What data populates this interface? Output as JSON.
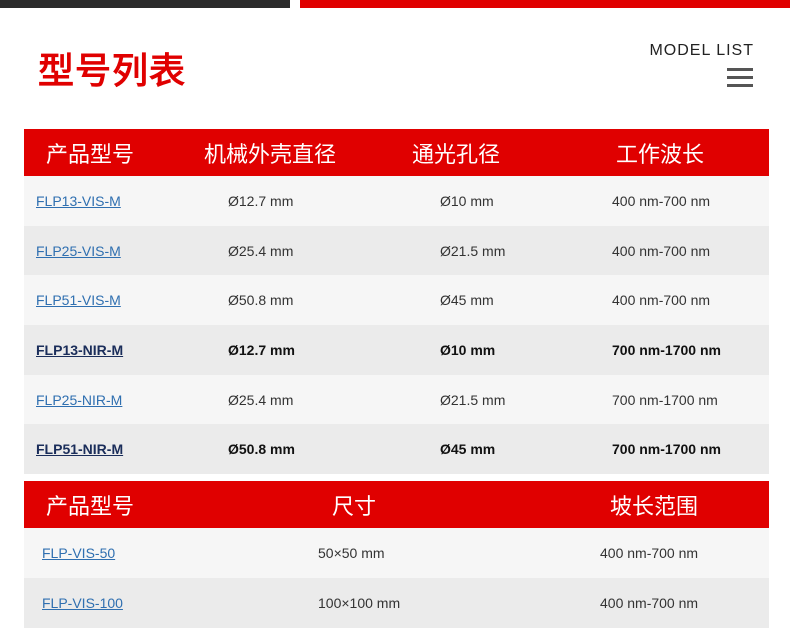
{
  "header": {
    "title": "型号列表",
    "model_list_label": "MODEL LIST"
  },
  "table1": {
    "columns": [
      "产品型号",
      "机械外壳直径",
      "通光孔径",
      "工作波长"
    ],
    "rows": [
      [
        "FLP13-VIS-M",
        "Ø12.7 mm",
        "Ø10 mm",
        "400 nm-700 nm"
      ],
      [
        "FLP25-VIS-M",
        "Ø25.4 mm",
        "Ø21.5 mm",
        "400 nm-700 nm"
      ],
      [
        "FLP51-VIS-M",
        "Ø50.8 mm",
        "Ø45 mm",
        "400 nm-700 nm"
      ],
      [
        "FLP13-NIR-M",
        "Ø12.7 mm",
        "Ø10 mm",
        "700 nm-1700 nm"
      ],
      [
        "FLP25-NIR-M",
        "Ø25.4 mm",
        "Ø21.5 mm",
        "700 nm-1700 nm"
      ],
      [
        "FLP51-NIR-M",
        "Ø50.8 mm",
        "Ø45 mm",
        "700 nm-1700 nm"
      ]
    ]
  },
  "table2": {
    "columns": [
      "产品型号",
      "尺寸",
      "坡长范围"
    ],
    "rows": [
      [
        "FLP-VIS-50",
        "50×50 mm",
        "400 nm-700 nm"
      ],
      [
        "FLP-VIS-100",
        "100×100 mm",
        "400 nm-700 nm"
      ]
    ]
  },
  "colors": {
    "accent": "#e00000",
    "link": "#2f6fb0",
    "dark_bar": "#2b2b2b"
  }
}
